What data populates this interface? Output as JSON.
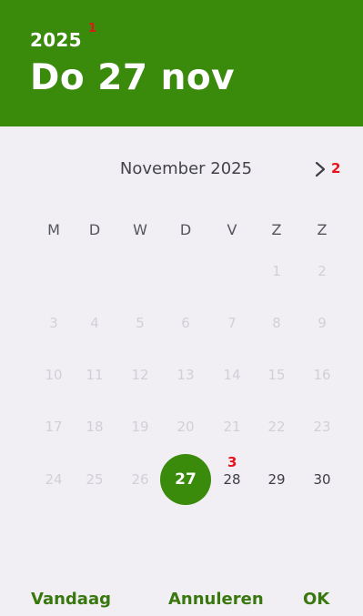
{
  "header": {
    "year": "2025",
    "selected_date": "Do 27 nov"
  },
  "calendar": {
    "month_title": "November 2025",
    "next_icon": "chevron-right-icon",
    "weekdays": [
      "M",
      "D",
      "W",
      "D",
      "V",
      "Z",
      "Z"
    ],
    "weeks": [
      [
        "",
        "",
        "",
        "",
        "",
        "1",
        "2"
      ],
      [
        "3",
        "4",
        "5",
        "6",
        "7",
        "8",
        "9"
      ],
      [
        "10",
        "11",
        "12",
        "13",
        "14",
        "15",
        "16"
      ],
      [
        "17",
        "18",
        "19",
        "20",
        "21",
        "22",
        "23"
      ],
      [
        "24",
        "25",
        "26",
        "27",
        "28",
        "29",
        "30"
      ]
    ],
    "selected_day": "27",
    "enabled_days": [
      "27",
      "28",
      "29",
      "30"
    ]
  },
  "actions": {
    "today": "Vandaag",
    "cancel": "Annuleren",
    "ok": "OK"
  },
  "markers": [
    "1",
    "2",
    "3"
  ],
  "colors": {
    "accent": "#3a8a0c",
    "marker": "#e8131b",
    "background": "#f1eff4"
  }
}
